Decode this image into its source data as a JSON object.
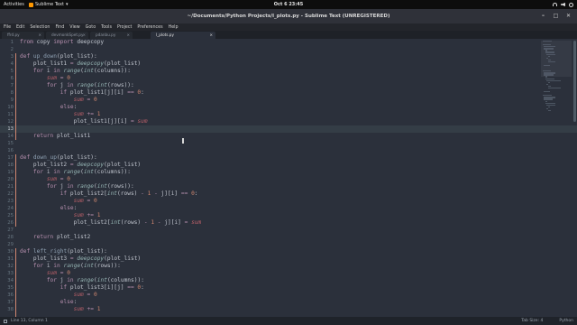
{
  "topbar": {
    "activities": "Activities",
    "app_name": "Sublime Text",
    "app_arrow": "▾",
    "clock": "Oct 6  23:45"
  },
  "window": {
    "title": "~/Documents/Python Projects/l_plots.py - Sublime Text (UNREGISTERED)"
  },
  "menu": [
    "File",
    "Edit",
    "Selection",
    "Find",
    "View",
    "Goto",
    "Tools",
    "Project",
    "Preferences",
    "Help"
  ],
  "tabs": [
    {
      "label": "ffrd.py",
      "close": "×"
    },
    {
      "label": "devmonkSpet.py",
      "close": "×"
    },
    {
      "label": "pdanbu.py",
      "close": "×"
    },
    {
      "label": "l_plots.py",
      "close": "×"
    }
  ],
  "editor": {
    "line_numbers": [
      "1",
      "2",
      "3",
      "4",
      "5",
      "6",
      "7",
      "8",
      "9",
      "10",
      "11",
      "12",
      "13",
      "14",
      "15",
      "16",
      "17",
      "18",
      "19",
      "20",
      "21",
      "22",
      "23",
      "24",
      "25",
      "26",
      "27",
      "28",
      "29",
      "30",
      "31",
      "32",
      "33",
      "34",
      "35",
      "36",
      "37",
      "38"
    ],
    "current_line": "13",
    "code_lines": [
      "from copy import deepcopy",
      "",
      "def up_down(plot_list):",
      "    plot_list1 = deepcopy(plot_list)",
      "    for i in range(int(columns)):",
      "        sum = 0",
      "        for j in range(int(rows)):",
      "            if plot_list1[j][i] == 0:",
      "                sum = 0",
      "            else:",
      "                sum += 1",
      "                plot_list1[j][i] = sum",
      "",
      "    return plot_list1",
      "",
      "",
      "def down_up(plot_list):",
      "    plot_list2 = deepcopy(plot_list)",
      "    for i in range(int(columns)):",
      "        sum = 0",
      "        for j in range(int(rows)):",
      "            if plot_list2[int(rows) - 1 - j][i] == 0:",
      "                sum = 0",
      "            else:",
      "                sum += 1",
      "                plot_list2[int(rows) - 1 - j][i] = sum",
      "",
      "    return plot_list2",
      "",
      "def left_right(plot_list):",
      "    plot_list3 = deepcopy(plot_list)",
      "    for i in range(int(rows)):",
      "        sum = 0",
      "        for j in range(int(columns)):",
      "            if plot_list3[i][j] == 0:",
      "                sum = 0",
      "            else:",
      "                sum += 1"
    ]
  },
  "statusbar": {
    "position": "Line 13, Column 1",
    "tab_size": "Tab Size: 4",
    "syntax": "Python"
  },
  "colors": {
    "background": "#2b303b",
    "keyword": "#b48ead",
    "function": "#8fa1b3",
    "number": "#d08770",
    "variable": "#bf616a"
  },
  "icons": [
    "sublime-app-icon",
    "network-icon",
    "volume-icon",
    "power-icon",
    "minimize-icon",
    "maximize-icon",
    "close-icon"
  ]
}
